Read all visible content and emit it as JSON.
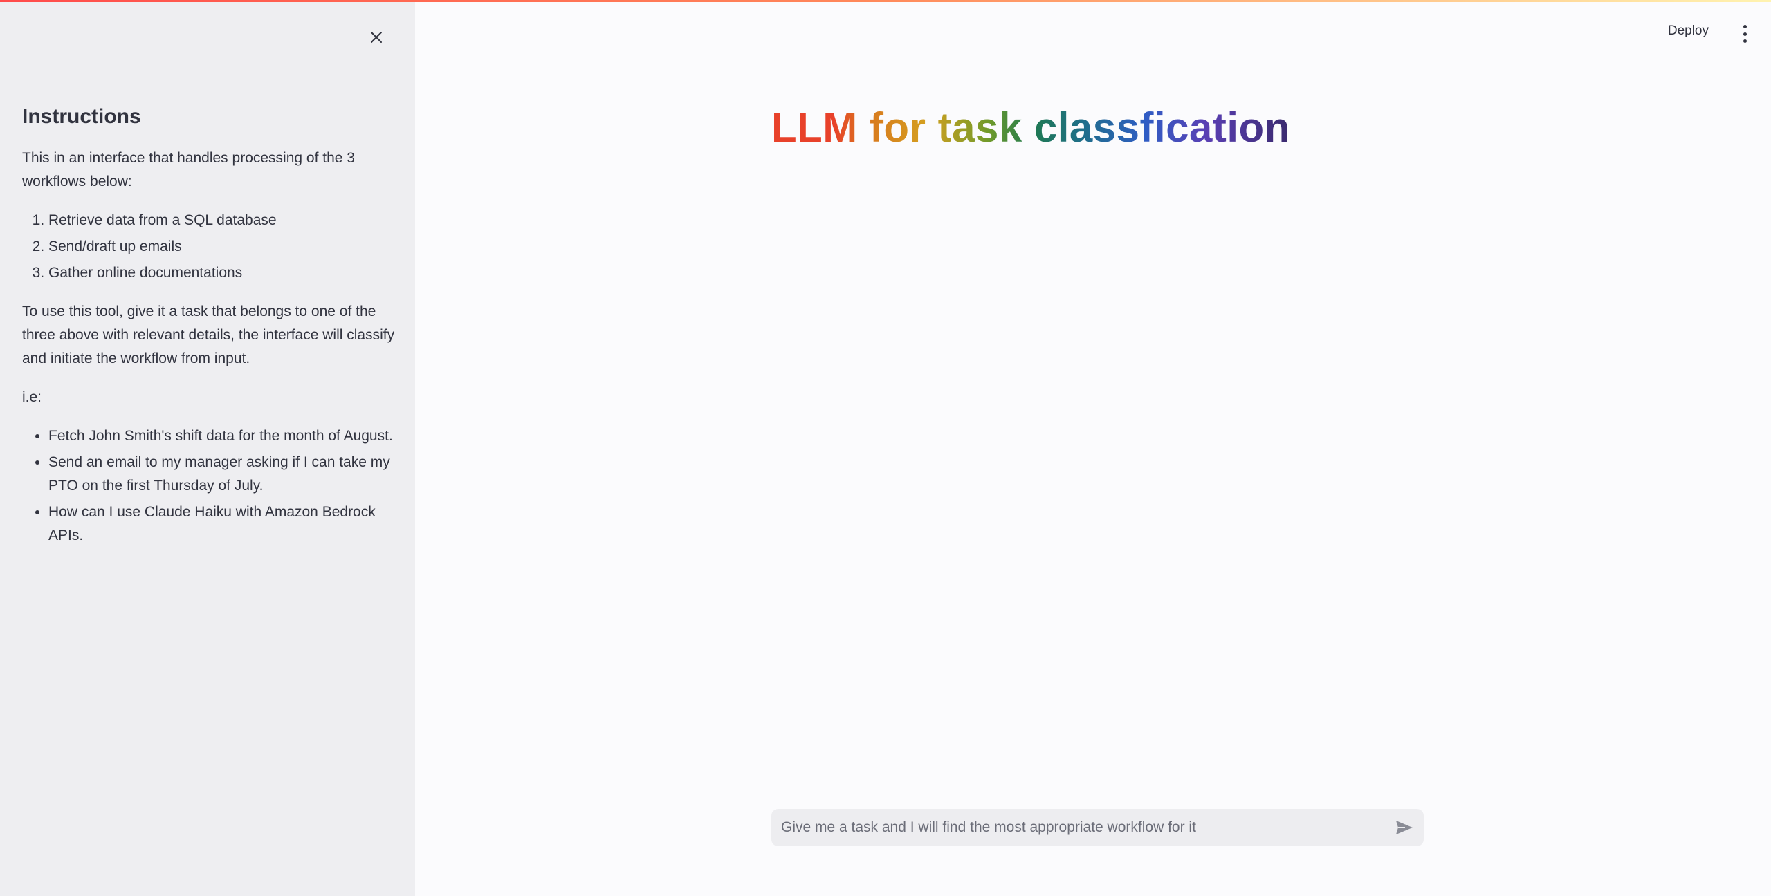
{
  "sidebar": {
    "close_icon": "close-icon",
    "heading": "Instructions",
    "intro": "This in an interface that handles processing of the 3 workflows below:",
    "workflows": [
      "Retrieve data from a SQL database",
      "Send/draft up emails",
      "Gather online documentations"
    ],
    "usage": "To use this tool, give it a task that belongs to one of the three above with relevant details, the interface will classify and initiate the workflow from input.",
    "example_label": "i.e:",
    "examples": [
      "Fetch John Smith's shift data for the month of August.",
      "Send an email to my manager asking if I can take my PTO on the first Thursday of July.",
      "How can I use Claude Haiku with Amazon Bedrock APIs."
    ]
  },
  "header": {
    "deploy_label": "Deploy",
    "menu_icon": "more-vertical-icon"
  },
  "main": {
    "title": "LLM for task classfication"
  },
  "chat": {
    "placeholder": "Give me a task and I will find the most appropriate workflow for it",
    "value": "",
    "send_icon": "send-icon"
  },
  "colors": {
    "accent_bar_start": "#ff4b4b",
    "sidebar_bg": "#eeeef1",
    "main_bg": "#fbfbfd",
    "text": "#31333f"
  }
}
